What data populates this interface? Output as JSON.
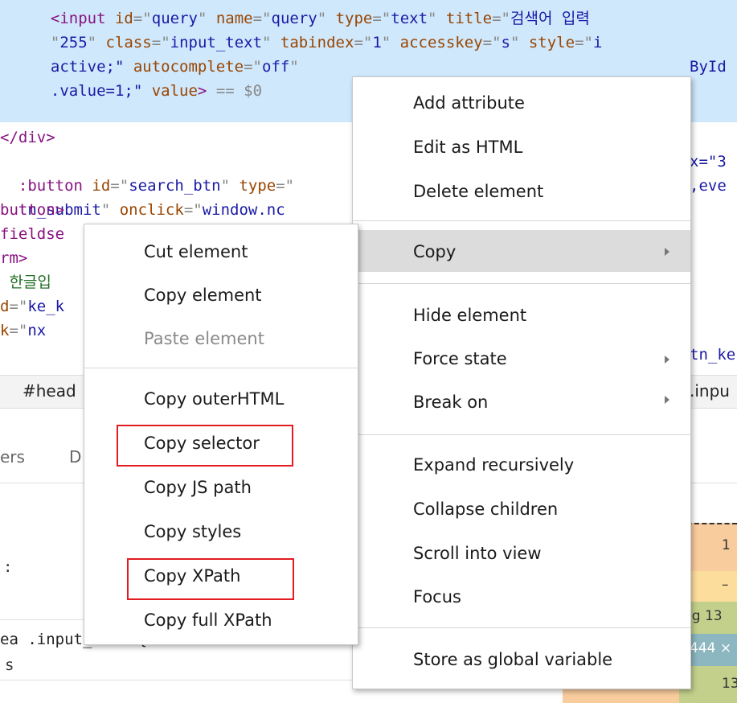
{
  "code_lines": [
    {
      "segments": [
        {
          "t": "  <",
          "c": "tag"
        },
        {
          "t": "input",
          "c": "tag"
        },
        {
          "t": " id",
          "c": "attr"
        },
        {
          "t": "=\"",
          "c": "gray"
        },
        {
          "t": "query",
          "c": "val"
        },
        {
          "t": "\"",
          "c": "gray"
        },
        {
          "t": " name",
          "c": "attr"
        },
        {
          "t": "=\"",
          "c": "gray"
        },
        {
          "t": "query",
          "c": "val"
        },
        {
          "t": "\"",
          "c": "gray"
        },
        {
          "t": " type",
          "c": "attr"
        },
        {
          "t": "=\"",
          "c": "gray"
        },
        {
          "t": "text",
          "c": "val"
        },
        {
          "t": "\"",
          "c": "gray"
        },
        {
          "t": " title",
          "c": "attr"
        },
        {
          "t": "=\"",
          "c": "gray"
        },
        {
          "t": "검색어 입력",
          "c": "val"
        }
      ]
    },
    {
      "segments": [
        {
          "t": "  \"",
          "c": "gray"
        },
        {
          "t": "255",
          "c": "val"
        },
        {
          "t": "\"",
          "c": "gray"
        },
        {
          "t": " class",
          "c": "attr"
        },
        {
          "t": "=\"",
          "c": "gray"
        },
        {
          "t": "input_text",
          "c": "val"
        },
        {
          "t": "\"",
          "c": "gray"
        },
        {
          "t": " tabindex",
          "c": "attr"
        },
        {
          "t": "=\"",
          "c": "gray"
        },
        {
          "t": "1",
          "c": "val"
        },
        {
          "t": "\"",
          "c": "gray"
        },
        {
          "t": " accesskey",
          "c": "attr"
        },
        {
          "t": "=\"",
          "c": "gray"
        },
        {
          "t": "s",
          "c": "val"
        },
        {
          "t": "\"",
          "c": "gray"
        },
        {
          "t": " style",
          "c": "attr"
        },
        {
          "t": "=\"",
          "c": "gray"
        },
        {
          "t": "i",
          "c": "val"
        }
      ]
    },
    {
      "segments": [
        {
          "t": "  active;\"",
          "c": "val"
        },
        {
          "t": " autocomplete",
          "c": "attr"
        },
        {
          "t": "=\"",
          "c": "gray"
        },
        {
          "t": "off",
          "c": "val"
        },
        {
          "t": "\"",
          "c": "gray"
        }
      ]
    },
    {
      "segments": [
        {
          "t": "  .value=1;\"",
          "c": "val"
        },
        {
          "t": " value",
          "c": "attr"
        },
        {
          "t": ">",
          "c": "tag"
        },
        {
          "t": " == ",
          "c": "gray"
        },
        {
          "t": "$0",
          "c": "gray"
        }
      ]
    }
  ],
  "code_right_fragments": {
    "line3": "ById"
  },
  "dom_lines": [
    {
      "text": "</div>",
      "cls": "tag"
    },
    {
      "text": "<button id=\"search_btn\" type=\"",
      "cls": "mix1"
    },
    {
      "text": "tn_submit\" onclick=\"window.nc",
      "cls": "mix2"
    },
    {
      "text": "button>",
      "cls": "tag"
    },
    {
      "text": "fieldse",
      "cls": "tag"
    },
    {
      "text": "rm>",
      "cls": "tag"
    },
    {
      "text": " 한글입",
      "cls": "kor"
    },
    {
      "text": "d=\"ke_k",
      "cls": "mix3"
    },
    {
      "text": "k=\"nx",
      "cls": "mix3"
    }
  ],
  "right_fragments": {
    "btn_type_tail": "x=\"3",
    "onclick_tail": ",eve",
    "ke_tail": "tn_ke"
  },
  "breadcrumb": {
    "left": "#head",
    "right": ".inpu"
  },
  "panel_tabs": {
    "tab1": "ers",
    "tab2": "D"
  },
  "styles_frag": {
    "line1": "ea .input_text {",
    "line_left": "s",
    "bullet": ":"
  },
  "box_model": {
    "v1": "1",
    "v2": "–",
    "v3": "ng 13",
    "v4": "444 ×",
    "v5": "13"
  },
  "main_menu": {
    "items": [
      {
        "label": "Add attribute",
        "submenu": false
      },
      {
        "label": "Edit as HTML",
        "submenu": false
      },
      {
        "label": "Delete element",
        "submenu": false
      },
      {
        "label": "Copy",
        "submenu": true,
        "highlighted": true
      },
      {
        "label": "Hide element",
        "submenu": false
      },
      {
        "label": "Force state",
        "submenu": true
      },
      {
        "label": "Break on",
        "submenu": true
      },
      {
        "label": "Expand recursively",
        "submenu": false
      },
      {
        "label": "Collapse children",
        "submenu": false
      },
      {
        "label": "Scroll into view",
        "submenu": false
      },
      {
        "label": "Focus",
        "submenu": false
      },
      {
        "label": "Store as global variable",
        "submenu": false
      }
    ]
  },
  "copy_submenu": {
    "items": [
      {
        "label": "Cut element",
        "disabled": false
      },
      {
        "label": "Copy element",
        "disabled": false
      },
      {
        "label": "Paste element",
        "disabled": true
      },
      {
        "label": "Copy outerHTML",
        "disabled": false
      },
      {
        "label": "Copy selector",
        "disabled": false,
        "boxed": true
      },
      {
        "label": "Copy JS path",
        "disabled": false
      },
      {
        "label": "Copy styles",
        "disabled": false
      },
      {
        "label": "Copy XPath",
        "disabled": false,
        "boxed": true
      },
      {
        "label": "Copy full XPath",
        "disabled": false
      }
    ]
  },
  "colors": {
    "highlight_box": "#e31c23",
    "selection_bg": "#cfe8fc",
    "menu_hover": "#dcdcdc"
  }
}
